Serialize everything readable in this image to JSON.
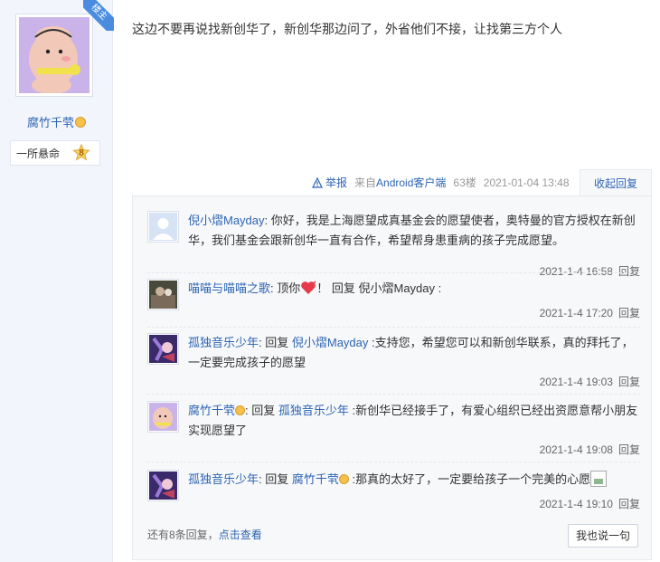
{
  "author": {
    "badge": "楼主",
    "name": "腐竹千茕",
    "level_title": "一所悬命",
    "level_num": "8"
  },
  "post": {
    "text": "这边不要再说找新创华了，新创华那边问了，外省他们不接，让找第三方个人",
    "report_label": "举报",
    "client_prefix": "来自",
    "client_name": "Android客户端",
    "floor": "63楼",
    "time": "2021-01-04 13:48",
    "collapse_label": "收起回复"
  },
  "replies": [
    {
      "user": "倪小熠Mayday",
      "sep": ": ",
      "content": "你好，我是上海愿望成真基金会的愿望使者，奥特曼的官方授权在新创华，我们基金会跟新创华一直有合作，希望帮身患重病的孩子完成愿望。",
      "time": "2021-1-4 16:58",
      "reply_label": "回复"
    },
    {
      "user": "喵喵与喵喵之歌",
      "sep": ": ",
      "content_pre": "顶你",
      "content_post": "！ 回复 倪小熠Mayday :",
      "time": "2021-1-4 17:20",
      "reply_label": "回复"
    },
    {
      "user": "孤独音乐少年",
      "sep": ": ",
      "reply_word": "回复 ",
      "target": "倪小熠Mayday",
      "content": " :支持您，希望您可以和新创华联系，真的拜托了，一定要完成孩子的愿望",
      "time": "2021-1-4 19:03",
      "reply_label": "回复"
    },
    {
      "user": "腐竹千茕",
      "sep": ": ",
      "reply_word": "回复 ",
      "target": "孤独音乐少年",
      "content": " :新创华已经接手了，有爱心组织已经出资愿意帮小朋友实现愿望了",
      "time": "2021-1-4 19:08",
      "reply_label": "回复"
    },
    {
      "user": "孤独音乐少年",
      "sep": ": ",
      "reply_word": "回复 ",
      "target": "腐竹千茕",
      "content": " :那真的太好了，一定要给孩子一个完美的心愿",
      "time": "2021-1-4 19:10",
      "reply_label": "回复"
    }
  ],
  "footer": {
    "more_text": "还有8条回复，",
    "view_link": "点击查看",
    "say_button": "我也说一句"
  },
  "colors": {
    "link": "#2d64b3",
    "sidebar_bg": "#f2f6fc",
    "reply_bg": "#f7f8fa"
  }
}
